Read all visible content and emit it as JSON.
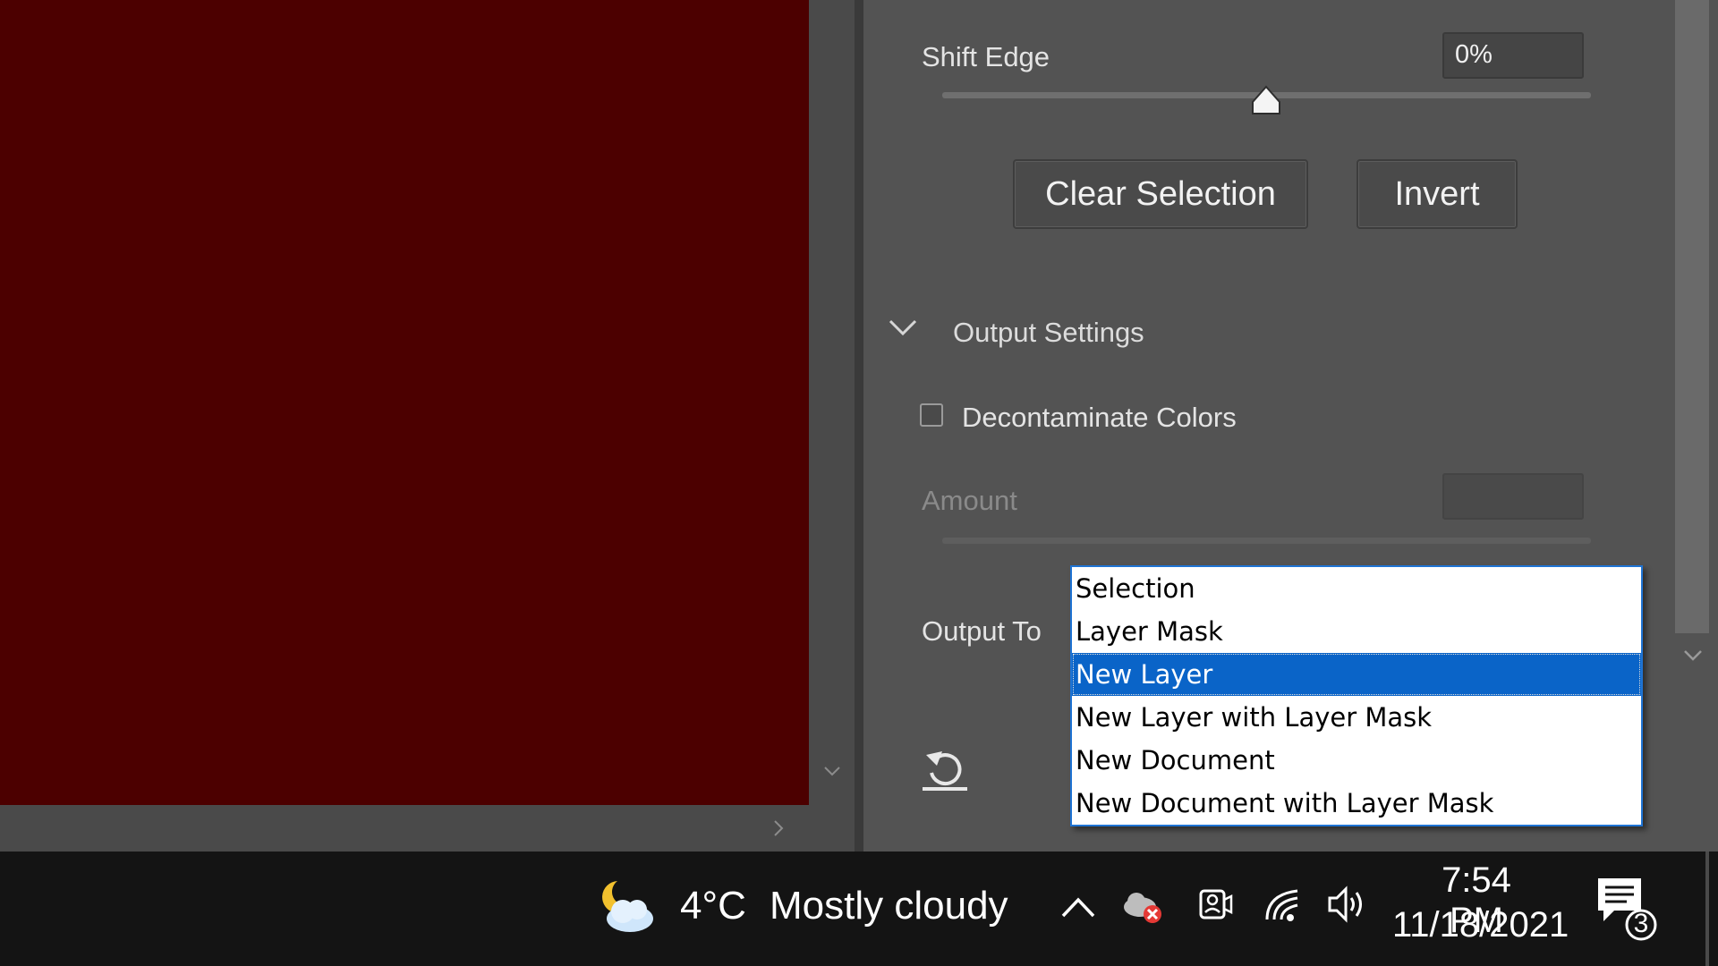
{
  "colors": {
    "canvas": "#4c0000",
    "panel": "#535353",
    "taskbar": "#141414",
    "dropdown_highlight": "#0a64c8"
  },
  "panel": {
    "shift_edge": {
      "label": "Shift Edge",
      "value": "0%",
      "slider_fraction": 0.5
    },
    "buttons": {
      "clear_selection": "Clear Selection",
      "invert": "Invert"
    },
    "output_settings": {
      "heading": "Output Settings",
      "decontaminate_label": "Decontaminate Colors",
      "decontaminate_checked": false,
      "amount_label": "Amount",
      "amount_value": "",
      "output_to_label": "Output To"
    },
    "icons": [
      "chevron-down-icon",
      "reset-icon"
    ]
  },
  "dropdown": {
    "options": [
      "Selection",
      "Layer Mask",
      "New Layer",
      "New Layer with Layer Mask",
      "New Document",
      "New Document with Layer Mask"
    ],
    "selected": "New Layer"
  },
  "taskbar": {
    "weather": {
      "icon": "partly-cloudy-night-icon",
      "temp": "4°C",
      "condition": "Mostly cloudy"
    },
    "tray_icons": [
      "chevron-up-icon",
      "onedrive-error-icon",
      "meet-now-icon",
      "wifi-icon",
      "volume-icon"
    ],
    "time": "7:54 PM",
    "date": "11/18/2021",
    "notifications": {
      "icon": "action-center-icon",
      "count": "3"
    }
  }
}
